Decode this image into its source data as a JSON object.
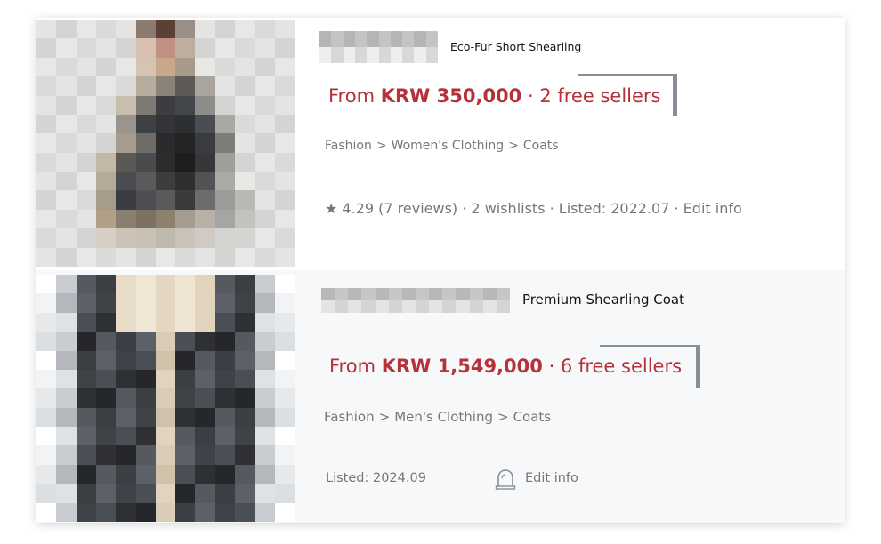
{
  "products": [
    {
      "title": "Eco-Fur Short Shearling",
      "price_prefix": "From",
      "price": "KRW 350,000",
      "sellers": "· 2 free sellers",
      "breadcrumb": [
        "Fashion",
        "Women's Clothing",
        "Coats"
      ],
      "breadcrumb_sep": ">",
      "rating": "★ 4.29",
      "reviews": "(7 reviews)",
      "wishlists": "· 2 wishlists",
      "listed": "· Listed: 2022.07",
      "edit": "· Edit info"
    },
    {
      "title": "Premium Shearling Coat",
      "price_prefix": "From",
      "price": "KRW 1,549,000",
      "sellers": "· 6 free sellers",
      "breadcrumb": [
        "Fashion",
        "Men's Clothing",
        "Coats"
      ],
      "breadcrumb_sep": ">",
      "listed": "Listed: 2024.09",
      "edit": "Edit info",
      "edit_icon": "alert-siren-icon"
    }
  ],
  "colors": {
    "price": "#b5323a",
    "muted": "#777777",
    "frame": "#8a8d96",
    "row_alt": "#f7f8fa"
  }
}
